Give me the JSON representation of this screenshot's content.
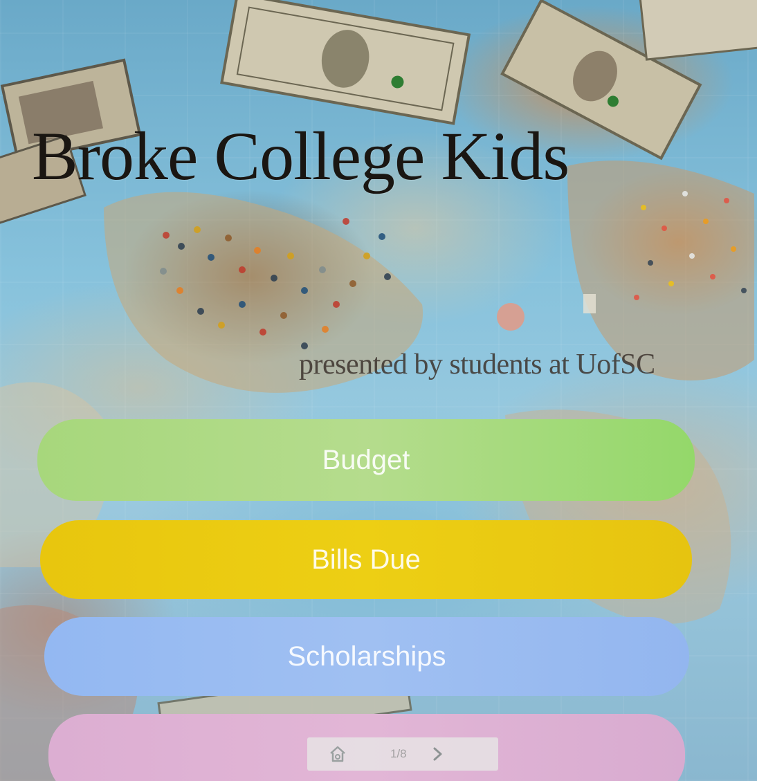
{
  "app": {
    "title": "Broke College Kids",
    "subtitle": "presented by students at UofSC"
  },
  "menu": {
    "buttons": [
      {
        "label": "Budget",
        "color": "#a7d77c"
      },
      {
        "label": "Bills Due",
        "color": "#e8c60e"
      },
      {
        "label": "Scholarships",
        "color": "#93b8f2"
      },
      {
        "label": "",
        "color": "#dcaed2"
      }
    ]
  },
  "pager": {
    "page_indicator": "1/8",
    "icons": [
      "home-icon",
      "chevron-right-icon"
    ]
  },
  "background": {
    "image": "world map with push pins and dollar bills"
  }
}
